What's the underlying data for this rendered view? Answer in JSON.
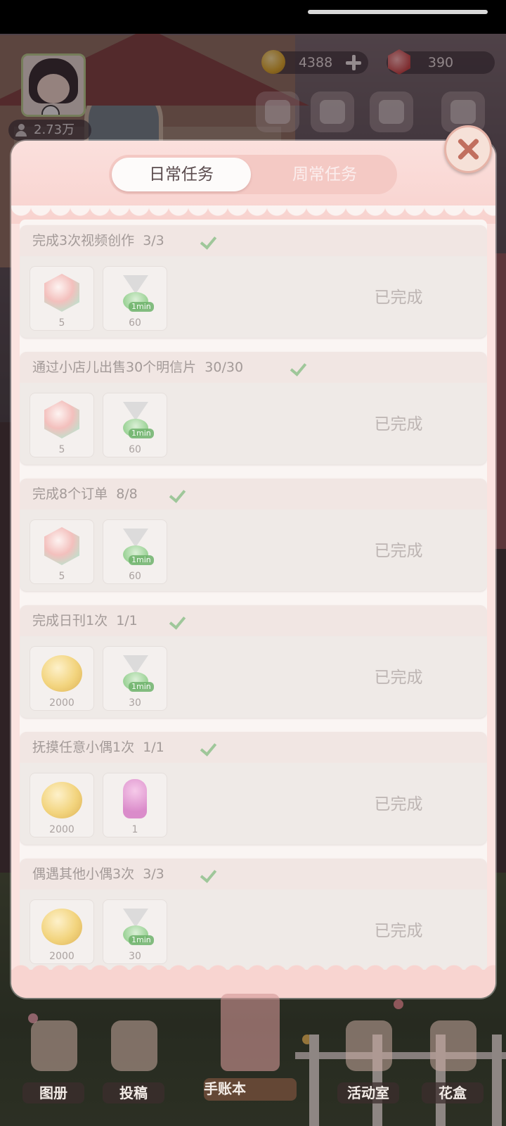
{
  "hud": {
    "fans": "2.73万",
    "coins": "4388",
    "gems": "390"
  },
  "tabs": [
    {
      "label": "日常任务",
      "active": true
    },
    {
      "label": "周常任务",
      "active": false
    }
  ],
  "tasks": [
    {
      "title": "完成3次视频创作",
      "progress": "3/3",
      "status": "已完成",
      "rewards": [
        {
          "icon": "gem-icon",
          "count": "5"
        },
        {
          "icon": "hourglass-icon",
          "tag": "1min",
          "count": "60"
        }
      ]
    },
    {
      "title": "通过小店儿出售30个明信片",
      "progress": "30/30",
      "status": "已完成",
      "rewards": [
        {
          "icon": "gem-icon",
          "count": "5"
        },
        {
          "icon": "hourglass-icon",
          "tag": "1min",
          "count": "60"
        }
      ]
    },
    {
      "title": "完成8个订单",
      "progress": "8/8",
      "status": "已完成",
      "rewards": [
        {
          "icon": "gem-icon",
          "count": "5"
        },
        {
          "icon": "hourglass-icon",
          "tag": "1min",
          "count": "60"
        }
      ]
    },
    {
      "title": "完成日刊1次",
      "progress": "1/1",
      "status": "已完成",
      "rewards": [
        {
          "icon": "coin-icon",
          "count": "2000"
        },
        {
          "icon": "hourglass-icon",
          "tag": "1min",
          "count": "30"
        }
      ]
    },
    {
      "title": "抚摸任意小偶1次",
      "progress": "1/1",
      "status": "已完成",
      "rewards": [
        {
          "icon": "coin-icon",
          "count": "2000"
        },
        {
          "icon": "doll-icon",
          "count": "1"
        }
      ]
    },
    {
      "title": "偶遇其他小偶3次",
      "progress": "3/3",
      "status": "已完成",
      "rewards": [
        {
          "icon": "coin-icon",
          "count": "2000"
        },
        {
          "icon": "hourglass-icon",
          "tag": "1min",
          "count": "30"
        }
      ]
    }
  ],
  "nav": [
    {
      "label": "图册"
    },
    {
      "label": "投稿"
    },
    {
      "label": "手账本"
    },
    {
      "label": "活动室"
    },
    {
      "label": "花盒"
    }
  ]
}
